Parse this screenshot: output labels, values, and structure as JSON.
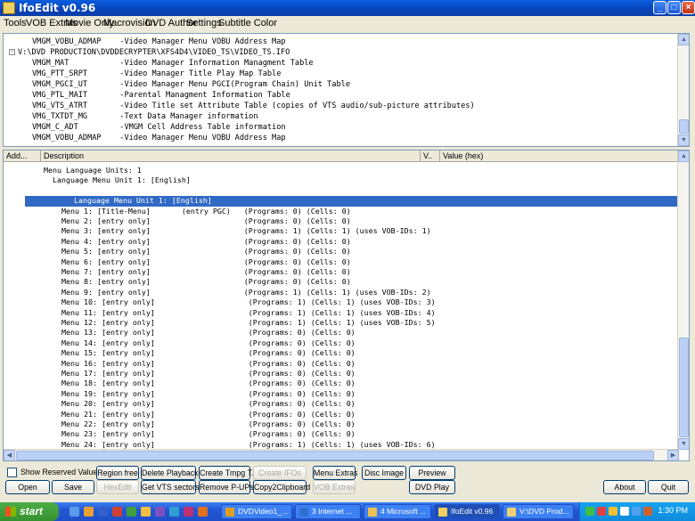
{
  "window": {
    "title": "IfoEdit v0.96"
  },
  "menu": [
    "Tools",
    "VOB Extras",
    "Movie Only",
    "Macrovision",
    "DVD Author",
    "Settings",
    "Subtitle Color"
  ],
  "tree": [
    "VMGM_VOBU_ADMAP    -Video Manager Menu VOBU Address Map",
    "V:\\DVD PRODUCTION\\DVDDECRYPTER\\XFS4D4\\VIDEO_TS\\VIDEO_TS.IFO",
    "VMGM_MAT           -Video Manager Information Managment Table",
    "VMG_PTT_SRPT       -Video Manager Title Play Map Table",
    "VMGM_PGCI_UT       -Video Manager Menu PGCI(Program Chain) Unit Table",
    "VMG_PTL_MAIT       -Parental Managment Information Table",
    "VMG_VTS_ATRT       -Video Title set Attribute Table (copies of VTS audio/sub-picture attributes)",
    "VMG_TXTDT_MG       -Text Data Manager information",
    "VMGM_C_ADT         -VMGM Cell Address Table information",
    "VMGM_VOBU_ADMAP    -Video Manager Menu VOBU Address Map"
  ],
  "list_headers": {
    "address": "Add...",
    "description": "Description",
    "value_short": "V..",
    "value_hex": "Value (hex)"
  },
  "list_rows": [
    "Menu Language Units: 1",
    "Language Menu Unit 1: [English]",
    "",
    "Language Menu Unit 1: [English]",
    "Menu 1: [Title-Menu]       (entry PGC)   (Programs: 0) (Cells: 0)",
    "Menu 2: [entry only]                     (Programs: 0) (Cells: 0)",
    "Menu 3: [entry only]                     (Programs: 1) (Cells: 1) (uses VOB-IDs: 1)",
    "Menu 4: [entry only]                     (Programs: 0) (Cells: 0)",
    "Menu 5: [entry only]                     (Programs: 0) (Cells: 0)",
    "Menu 6: [entry only]                     (Programs: 0) (Cells: 0)",
    "Menu 7: [entry only]                     (Programs: 0) (Cells: 0)",
    "Menu 8: [entry only]                     (Programs: 0) (Cells: 0)",
    "Menu 9: [entry only]                     (Programs: 1) (Cells: 1) (uses VOB-IDs: 2)",
    "Menu 10: [entry only]                     (Programs: 1) (Cells: 1) (uses VOB-IDs: 3)",
    "Menu 11: [entry only]                     (Programs: 1) (Cells: 1) (uses VOB-IDs: 4)",
    "Menu 12: [entry only]                     (Programs: 1) (Cells: 1) (uses VOB-IDs: 5)",
    "Menu 13: [entry only]                     (Programs: 0) (Cells: 0)",
    "Menu 14: [entry only]                     (Programs: 0) (Cells: 0)",
    "Menu 15: [entry only]                     (Programs: 0) (Cells: 0)",
    "Menu 16: [entry only]                     (Programs: 0) (Cells: 0)",
    "Menu 17: [entry only]                     (Programs: 0) (Cells: 0)",
    "Menu 18: [entry only]                     (Programs: 0) (Cells: 0)",
    "Menu 19: [entry only]                     (Programs: 0) (Cells: 0)",
    "Menu 20: [entry only]                     (Programs: 0) (Cells: 0)",
    "Menu 21: [entry only]                     (Programs: 0) (Cells: 0)",
    "Menu 22: [entry only]                     (Programs: 0) (Cells: 0)",
    "Menu 23: [entry only]                     (Programs: 0) (Cells: 0)",
    "Menu 24: [entry only]                     (Programs: 1) (Cells: 1) (uses VOB-IDs: 6)"
  ],
  "buttons": {
    "show_reserved": "Show Reserved Values",
    "region_free": "Region free",
    "delete_playback": "Delete Playback",
    "create_tmpgt": "Create Tmpg T.",
    "create_ifos": "Create IFOs",
    "menu_extras": "Menu Extras",
    "disc_image": "Disc Image",
    "preview": "Preview",
    "open": "Open",
    "save": "Save",
    "hexedit": "HexEdit",
    "get_vts_sectors": "Get VTS sectors",
    "remove_pups": "Remove P-UPs",
    "copy2clipboard": "Copy2Clipboard",
    "vob_extras": "VOB Extras",
    "dvd_play": "DVD Play",
    "about": "About",
    "quit": "Quit"
  },
  "taskbar": {
    "start": "start",
    "tasks": [
      "DVDVideo1_...",
      "3 Internet ...",
      "4 Microsoft ...",
      "IfoEdit v0.96",
      "V:\\DVD Prod..."
    ],
    "clock": "1:30 PM"
  }
}
